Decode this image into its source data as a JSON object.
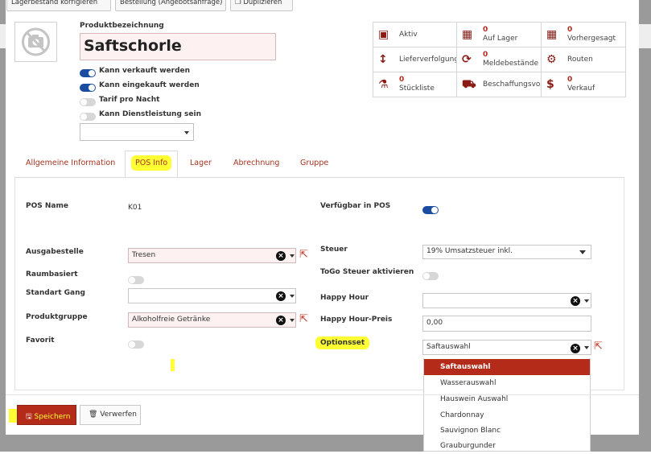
{
  "toolbar": {
    "correct_stock_label": "Lagerbestand korrigieren",
    "order_label": "Bestellung (Angebotsanfrage)",
    "duplicate_label": "Duplizieren"
  },
  "product": {
    "name_label": "Produktbezeichnung",
    "name_value": "Saftschorle",
    "toggles": [
      {
        "label": "Kann verkauft werden",
        "on": true
      },
      {
        "label": "Kann eingekauft werden",
        "on": true
      },
      {
        "label": "Tarif pro Nacht",
        "on": false
      },
      {
        "label": "Kann Dienstleistung sein",
        "on": false
      }
    ],
    "type_select_value": ""
  },
  "stats": [
    {
      "icon": "archive-icon",
      "number": "",
      "label": "Aktiv"
    },
    {
      "icon": "building-icon",
      "number": "0",
      "label": "Auf Lager"
    },
    {
      "icon": "building-icon",
      "number": "0",
      "label": "Vorhergesagt"
    },
    {
      "icon": "arrows-vertical-icon",
      "number": "",
      "label": "Lieferverfolgung"
    },
    {
      "icon": "refresh-icon",
      "number": "0",
      "label": "Meldebestände"
    },
    {
      "icon": "cogs-icon",
      "number": "",
      "label": "Routen"
    },
    {
      "icon": "flask-icon",
      "number": "0",
      "label": "Stückliste"
    },
    {
      "icon": "truck-icon",
      "number": "",
      "label": "Beschaffungsvorgänge"
    },
    {
      "icon": "dollar-icon",
      "number": "0",
      "label": "Verkauf"
    }
  ],
  "tabs": [
    {
      "label": "Allgemeine Information"
    },
    {
      "label": "POS Info",
      "active": true
    },
    {
      "label": "Lager"
    },
    {
      "label": "Abrechnung"
    },
    {
      "label": "Gruppe"
    }
  ],
  "pos": {
    "pos_name_label": "POS Name",
    "pos_name_value": "K01",
    "available_label": "Verfügbar in POS",
    "available_on": true,
    "output_label": "Ausgabestelle",
    "output_value": "Tresen",
    "room_label": "Raumbasiert",
    "room_on": false,
    "course_label": "Standart Gang",
    "course_value": "",
    "group_label": "Produktgruppe",
    "group_value": "Alkoholfreie Getränke",
    "favorite_label": "Favorit",
    "favorite_on": false,
    "tax_label": "Steuer",
    "tax_value": "19% Umsatzsteuer inkl.",
    "togo_label": "ToGo Steuer aktivieren",
    "togo_on": false,
    "happy_hour_label": "Happy Hour",
    "happy_hour_value": "",
    "happy_price_label": "Happy Hour-Preis",
    "happy_price_value": "0,00",
    "optionset_label": "Optionsset",
    "optionset_value": "Saftauswahl",
    "optionset_options": [
      {
        "label": "Saftauswahl",
        "selected": true
      },
      {
        "label": "Wasserauswahl"
      },
      {
        "label": "Hauswein Auswahl"
      },
      {
        "label": "Chardonnay"
      },
      {
        "label": "Sauvignon Blanc"
      },
      {
        "label": "Grauburgunder"
      }
    ]
  },
  "footer": {
    "save_label": "Speichern",
    "discard_label": "Verwerfen"
  },
  "colors": {
    "accent": "#b52b19",
    "toggle_on": "#1a4da0",
    "highlight": "#ffff33"
  }
}
